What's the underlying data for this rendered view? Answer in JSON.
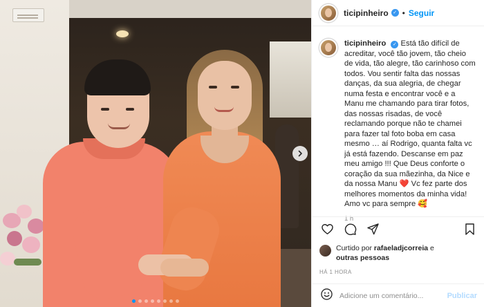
{
  "post": {
    "author": "ticipinheiro",
    "verified": true,
    "follow_label": "Seguir",
    "separator": "•",
    "caption": "Está tão difícil de acreditar, você tão jovem, tão cheio de vida, tão alegre, tão carinhoso com todos. Vou sentir falta das nossas danças, da sua alegria, de chegar numa festa e encontrar você e a Manu me chamando para tirar fotos, das nossas risadas, de você reclamando porque não te chamei para fazer tal foto boba em casa mesmo … aí Rodrigo, quanta falta vc já está fazendo. Descanse em paz meu amigo !!! Que Deus conforte o coração da sua mãezinha, da Nice e da nossa Manu ❤️ Vc fez parte dos melhores momentos da minha vida! Amo vc para sempre 🥰",
    "time_ago": "1 h",
    "carousel": {
      "total": 8,
      "active_index": 0,
      "next_icon": "chevron-right-icon"
    }
  },
  "likes": {
    "prefix": "Curtido por ",
    "user": "rafaeladjcorreia",
    "connector": " e",
    "others": "outras pessoas"
  },
  "date_label": "HÁ 1 HORA",
  "comment_box": {
    "placeholder": "Adicione um comentário...",
    "publish_label": "Publicar"
  },
  "icons": {
    "like": "heart-icon",
    "comment": "comment-icon",
    "share": "paper-plane-icon",
    "save": "bookmark-icon",
    "emoji": "smiley-icon"
  },
  "colors": {
    "accent": "#0095f6",
    "publish_disabled": "#b3dbff",
    "verified": "#3897f0",
    "muted_text": "#8e8e8e"
  }
}
